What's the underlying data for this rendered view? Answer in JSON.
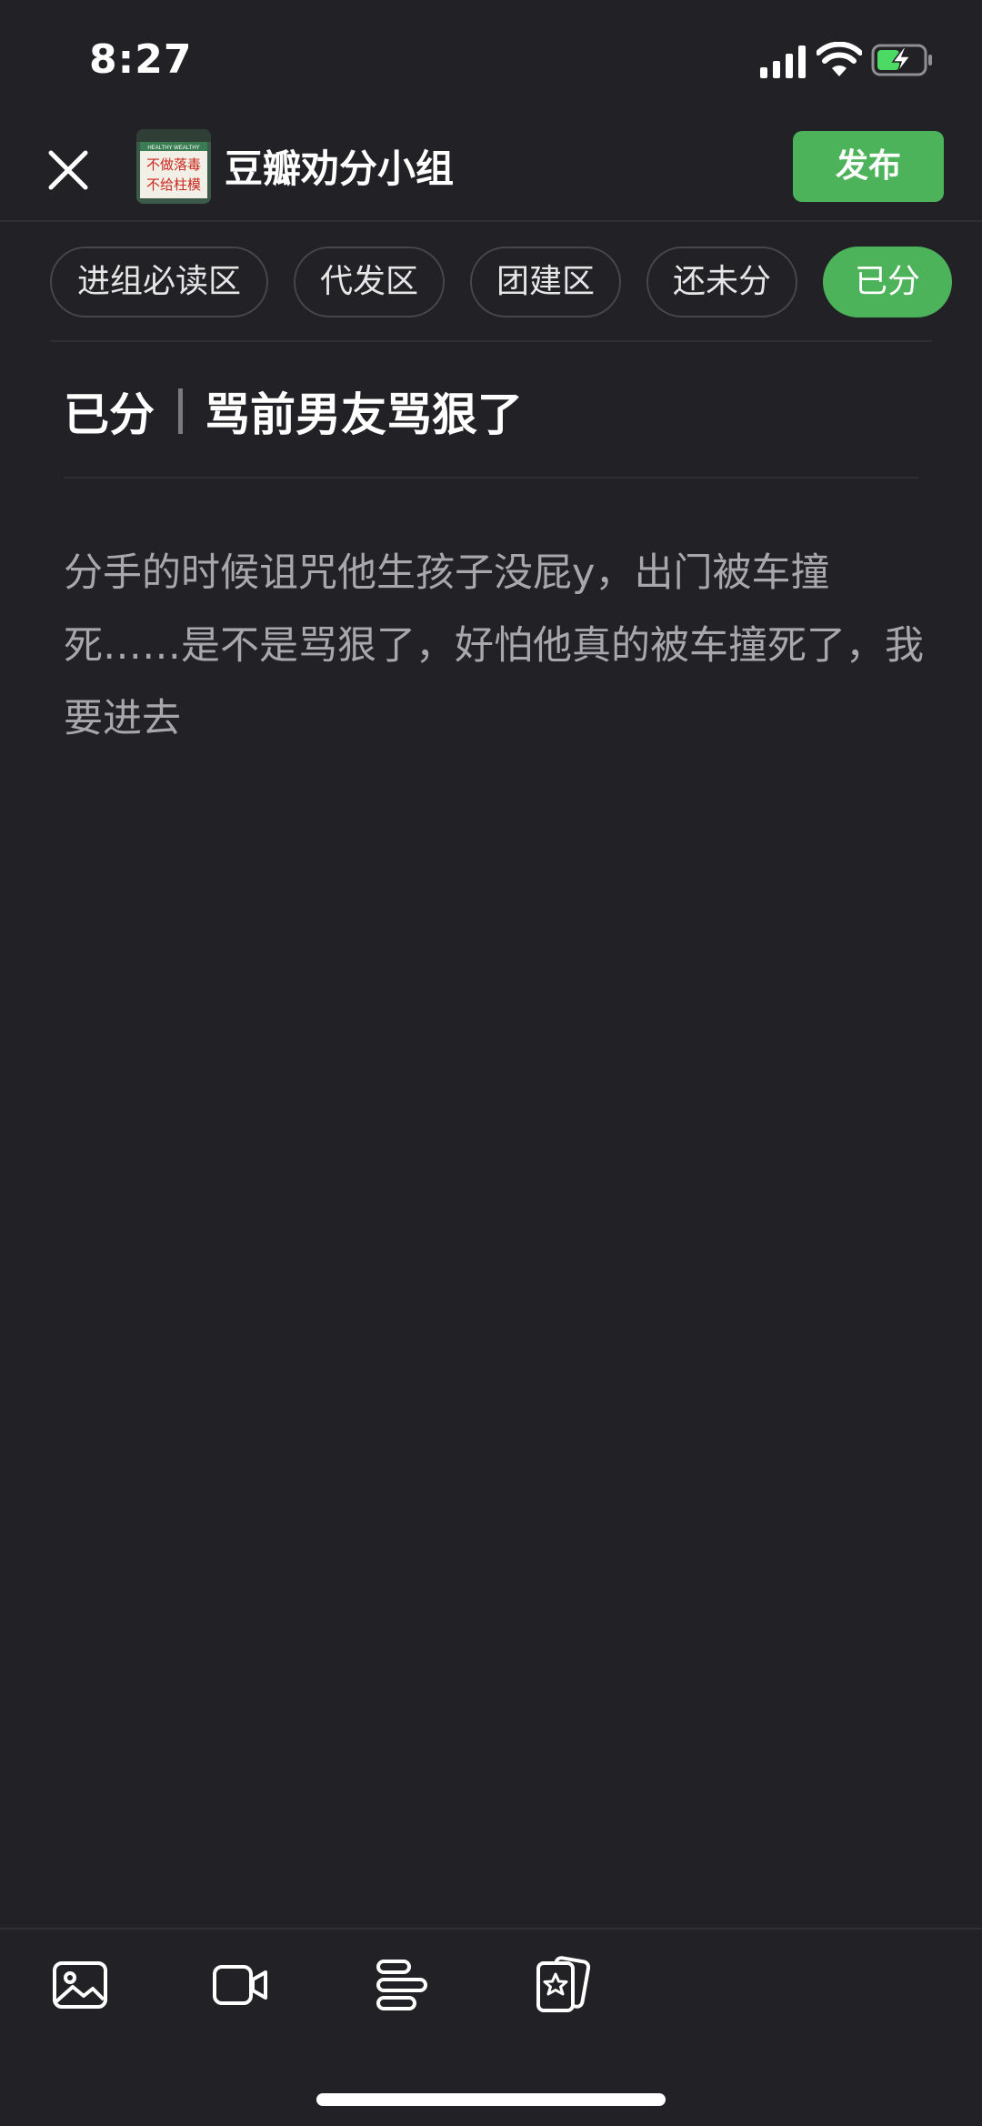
{
  "status_bar": {
    "time": "8:27",
    "icons": [
      "signal-icon",
      "wifi-icon",
      "battery-charging-icon"
    ],
    "battery_color": "#4cd964"
  },
  "header": {
    "group_name": "豆瓣劝分小组",
    "avatar_sign": {
      "top_text": "HEALTHY WEALTHY",
      "line1": "不做落毒",
      "line2": "不给柱模"
    },
    "publish_label": "发布",
    "publish_color": "#4cb35a"
  },
  "tabs": [
    {
      "label": "进组必读区",
      "active": false
    },
    {
      "label": "代发区",
      "active": false
    },
    {
      "label": "团建区",
      "active": false
    },
    {
      "label": "还未分",
      "active": false
    },
    {
      "label": "已分",
      "active": true
    }
  ],
  "post": {
    "category": "已分",
    "title": "骂前男友骂狠了",
    "body": "分手的时候诅咒他生孩子没屁y，出门被车撞死……是不是骂狠了，好怕他真的被车撞死了，我要进去"
  },
  "toolbar": {
    "icons": [
      "image-icon",
      "video-icon",
      "text-format-icon",
      "sticker-card-icon"
    ]
  }
}
